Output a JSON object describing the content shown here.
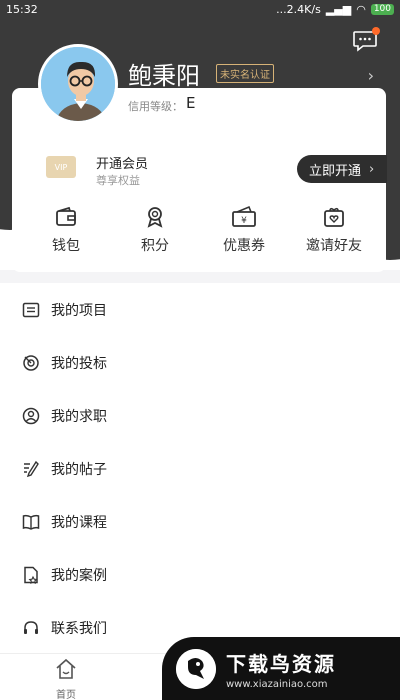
{
  "status_bar": {
    "time": "15:32",
    "network_speed": "...2.4K/s",
    "battery": "100"
  },
  "profile": {
    "name": "鲍秉阳",
    "verify_badge": "未实名认证",
    "credit_label": "信用等级：",
    "credit_value": "E"
  },
  "vip": {
    "icon_label": "VIP",
    "title": "开通会员",
    "subtitle": "尊享权益",
    "button_label": "立即开通"
  },
  "quick_actions": [
    {
      "label": "钱包",
      "icon": "wallet-icon"
    },
    {
      "label": "积分",
      "icon": "medal-icon"
    },
    {
      "label": "优惠券",
      "icon": "coupon-icon"
    },
    {
      "label": "邀请好友",
      "icon": "gift-icon"
    }
  ],
  "menu": [
    {
      "label": "我的项目",
      "icon": "folder-icon"
    },
    {
      "label": "我的投标",
      "icon": "bid-icon"
    },
    {
      "label": "我的求职",
      "icon": "person-icon"
    },
    {
      "label": "我的帖子",
      "icon": "edit-icon"
    },
    {
      "label": "我的课程",
      "icon": "book-icon"
    },
    {
      "label": "我的案例",
      "icon": "case-icon"
    },
    {
      "label": "联系我们",
      "icon": "headset-icon"
    }
  ],
  "tabbar": {
    "home_label": "首页"
  },
  "watermark": {
    "title": "下载鸟资源",
    "url": "www.xiazainiao.com"
  },
  "colors": {
    "header": "#3a3a3a",
    "gold": "#d6b277",
    "notify": "#ff6a2a"
  }
}
